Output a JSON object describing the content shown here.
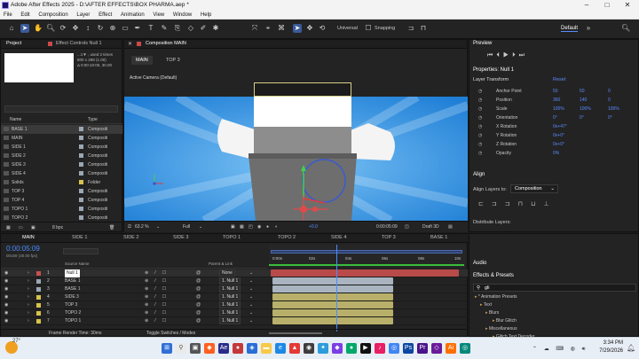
{
  "window": {
    "title": "Adobe After Effects 2025 - D:\\AFTER EFFECTS\\BOX PHARMA.aep *",
    "min": "–",
    "max": "□",
    "close": "✕"
  },
  "menu": [
    "File",
    "Edit",
    "Composition",
    "Layer",
    "Effect",
    "Animation",
    "View",
    "Window",
    "Help"
  ],
  "toolbar": {
    "universal": "Universal",
    "snapping": "Snapping",
    "workspace": "Default"
  },
  "project": {
    "tab_project": "Project",
    "tab_effect_controls": "Effect Controls Null 1",
    "info_line1": "...1▼ , used 2 times",
    "info_line2": "800 x 298 (1.00)",
    "info_line3": "Δ 0:00:10:00, 30.00",
    "col_name": "Name",
    "col_type": "Type",
    "items": [
      {
        "name": "BASE 1",
        "type": "Compositi",
        "color": "#9aa7b5"
      },
      {
        "name": "MAIN",
        "type": "Compositi",
        "color": "#9aa7b5"
      },
      {
        "name": "SIDE 1",
        "type": "Compositi",
        "color": "#9aa7b5"
      },
      {
        "name": "SIDE 2",
        "type": "Compositi",
        "color": "#9aa7b5"
      },
      {
        "name": "SIDE 3",
        "type": "Compositi",
        "color": "#9aa7b5"
      },
      {
        "name": "SIDE 4",
        "type": "Compositi",
        "color": "#9aa7b5"
      },
      {
        "name": "Solids",
        "type": "Folder",
        "color": "#d8c34a"
      },
      {
        "name": "TOP 3",
        "type": "Compositi",
        "color": "#9aa7b5"
      },
      {
        "name": "TOP 4",
        "type": "Compositi",
        "color": "#9aa7b5"
      },
      {
        "name": "TOPO 1",
        "type": "Compositi",
        "color": "#9aa7b5"
      },
      {
        "name": "TOPO 2",
        "type": "Compositi",
        "color": "#9aa7b5"
      }
    ],
    "bpc": "8 bpc"
  },
  "composition": {
    "tab": "Composition MAIN",
    "subtabs": [
      "MAIN",
      "TOP 3"
    ],
    "camera": "Active Camera (Default)",
    "zoom": "63.2 %",
    "quality": "Full",
    "timecode": "0:00:05:09",
    "renderer": "Draft 3D",
    "exposure": "+0.0"
  },
  "timeline": {
    "tabs": [
      "MAIN",
      "SIDE 1",
      "SIDE 2",
      "SIDE 3",
      "TOPO 1",
      "TOPO 2",
      "SIDE 4",
      "TOP 3",
      "BASE 1"
    ],
    "timecode": "0:00:05:09",
    "frame": "00159 (30.00 fps)",
    "col_source": "Source Name",
    "col_parent": "Parent & Link",
    "ruler": [
      "0:00s",
      "02s",
      "04s",
      "06s",
      "08s",
      "10s"
    ],
    "layers": [
      {
        "num": "1",
        "name": "Null 1",
        "parent": "None",
        "color": "#c85050",
        "bar": "#b94a4a"
      },
      {
        "num": "2",
        "name": "BASE 1",
        "parent": "1. Null 1",
        "color": "#9aa7b5",
        "bar": "#a9b4c0"
      },
      {
        "num": "3",
        "name": "BASE 1",
        "parent": "1. Null 1",
        "color": "#9aa7b5",
        "bar": "#a9b4c0"
      },
      {
        "num": "4",
        "name": "SIDE 3",
        "parent": "1. Null 1",
        "color": "#d8c34a",
        "bar": "#b8b06a"
      },
      {
        "num": "5",
        "name": "TOP 3",
        "parent": "1. Null 1",
        "color": "#d8c34a",
        "bar": "#b8b06a"
      },
      {
        "num": "6",
        "name": "TOPO 2",
        "parent": "1. Null 1",
        "color": "#d8c34a",
        "bar": "#b8b06a"
      },
      {
        "num": "7",
        "name": "TOPO 1",
        "parent": "1. Null 1",
        "color": "#d8c34a",
        "bar": "#b8b06a"
      }
    ],
    "footer_render": "Frame Render Time: 30ms",
    "footer_toggle": "Toggle Switches / Modes"
  },
  "preview": {
    "title": "Preview"
  },
  "properties": {
    "title": "Properties: Null 1",
    "section": "Layer Transform",
    "reset": "Reset",
    "rows": [
      {
        "label": "Anchor Point",
        "v1": "50",
        "v2": "50",
        "v3": "0"
      },
      {
        "label": "Position",
        "v1": "360",
        "v2": "140",
        "v3": "0"
      },
      {
        "label": "Scale",
        "v1": "100%",
        "v2": "100%",
        "v3": "100%"
      },
      {
        "label": "Orientation",
        "v1": "0°",
        "v2": "0°",
        "v3": "0°"
      },
      {
        "label": "X Rotation",
        "v1": "0x+47°",
        "v2": "",
        "v3": ""
      },
      {
        "label": "Y Rotation",
        "v1": "0x+0°",
        "v2": "",
        "v3": ""
      },
      {
        "label": "Z Rotation",
        "v1": "0x+0°",
        "v2": "",
        "v3": ""
      },
      {
        "label": "Opacity",
        "v1": "0%",
        "v2": "",
        "v3": ""
      }
    ]
  },
  "align": {
    "title": "Align",
    "align_to_label": "Align Layers to:",
    "align_to_value": "Composition",
    "distribute": "Distribute Layers:"
  },
  "audio": {
    "title": "Audio"
  },
  "effects": {
    "title": "Effects & Presets",
    "search": "gli",
    "tree": [
      "* Animation Presets",
      "Text",
      "Blurs",
      "Blur Glitch",
      "Miscellaneous",
      "Glitch Text Decoder"
    ]
  },
  "taskbar": {
    "weather": "27°",
    "time": "3:34 PM",
    "date": "7/29/2026"
  }
}
